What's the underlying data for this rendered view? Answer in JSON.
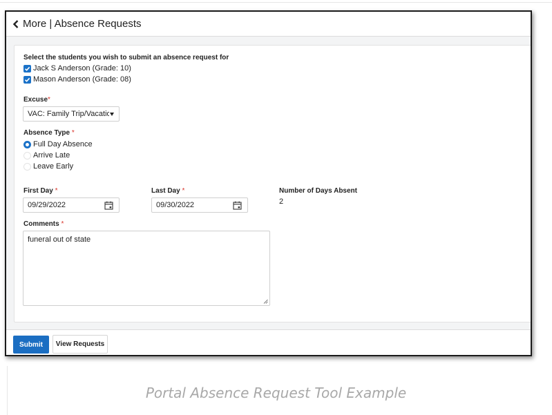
{
  "header": {
    "title": "More | Absence Requests"
  },
  "form": {
    "students_label": "Select the students you wish to submit an absence request for",
    "students": [
      {
        "name": "Jack S Anderson (Grade: 10)",
        "checked": true
      },
      {
        "name": "Mason Anderson (Grade: 08)",
        "checked": true
      }
    ],
    "excuse_label": "Excuse",
    "excuse_value": "VAC: Family Trip/Vacation",
    "absence_type_label": "Absence Type",
    "absence_types": [
      {
        "label": "Full Day Absence",
        "selected": true
      },
      {
        "label": "Arrive Late",
        "selected": false
      },
      {
        "label": "Leave Early",
        "selected": false
      }
    ],
    "first_day_label": "First Day",
    "first_day_value": "09/29/2022",
    "last_day_label": "Last Day",
    "last_day_value": "09/30/2022",
    "days_absent_label": "Number of Days Absent",
    "days_absent_value": "2",
    "comments_label": "Comments",
    "comments_value": "funeral out of state",
    "required_marker": "*"
  },
  "footer": {
    "submit_label": "Submit",
    "view_label": "View Requests"
  },
  "caption": "Portal Absence Request Tool Example",
  "colors": {
    "accent": "#1b72c8",
    "required": "#d9342b"
  }
}
